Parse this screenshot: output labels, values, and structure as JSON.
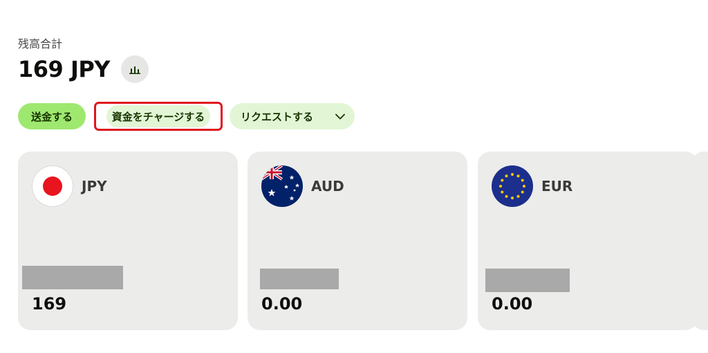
{
  "balance": {
    "label": "残高合計",
    "amount": "169 JPY"
  },
  "chart_button": {
    "icon": "bar-chart-icon"
  },
  "actions": {
    "send_label": "送金する",
    "add_money_label": "資金をチャージする",
    "request_label": "リクエストする",
    "request_icon": "chevron-down-icon"
  },
  "cards": [
    {
      "code": "JPY",
      "flag": "japan-flag-icon",
      "amount": "169"
    },
    {
      "code": "AUD",
      "flag": "australia-flag-icon",
      "amount": "0.00"
    },
    {
      "code": "EUR",
      "flag": "eu-flag-icon",
      "amount": "0.00"
    }
  ],
  "colors": {
    "accent_green": "#9fe870",
    "light_green": "#e2f6d5",
    "button_text": "#163300",
    "highlight_red": "#e0141e",
    "card_bg": "#ecedea",
    "redaction_gray": "#a9a9a9"
  }
}
